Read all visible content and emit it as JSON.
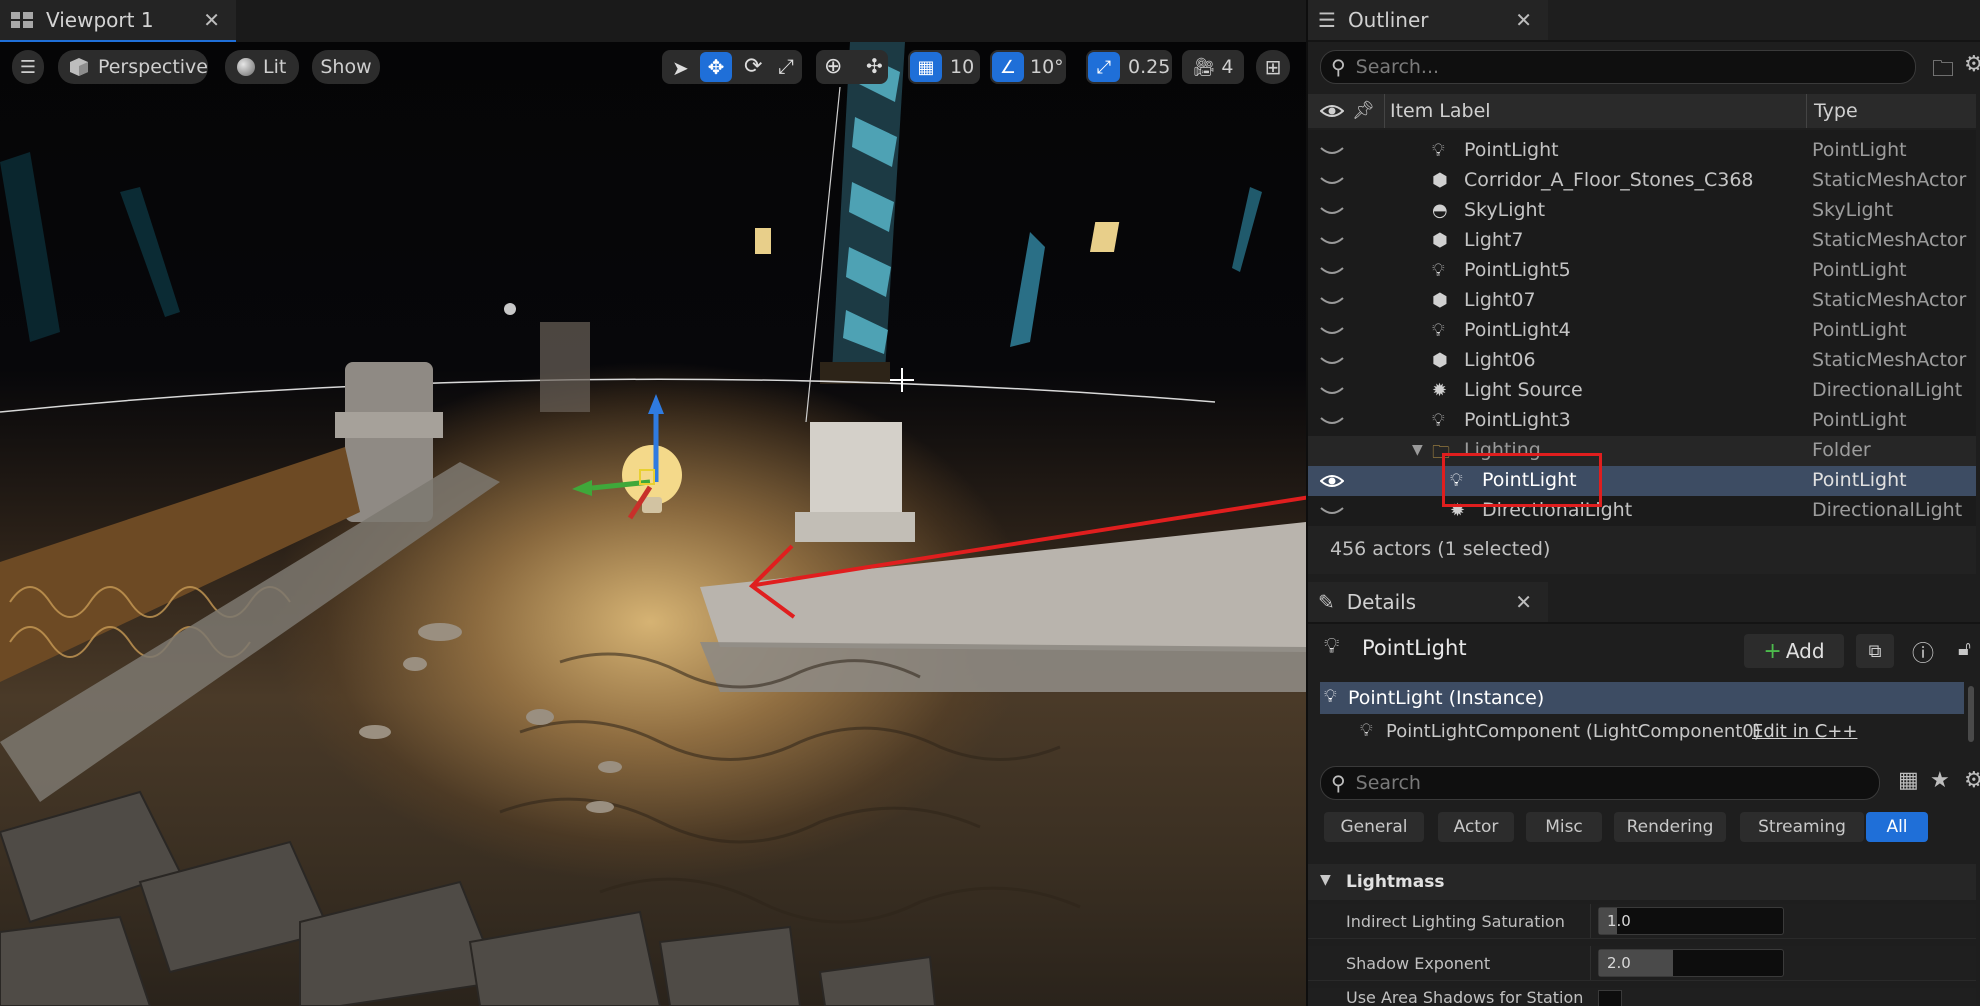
{
  "viewport": {
    "tab_title": "Viewport 1",
    "toolbar": {
      "perspective_label": "Perspective",
      "lit_label": "Lit",
      "show_label": "Show",
      "grid_snap_value": "10",
      "rotation_snap_value": "10°",
      "scale_snap_value": "0.25",
      "camera_speed_value": "4"
    }
  },
  "outliner": {
    "tab_title": "Outliner",
    "search_placeholder": "Search...",
    "col_item_label": "Item Label",
    "col_type": "Type",
    "rows": [
      {
        "label": "PointLight",
        "type": "PointLight",
        "icon": "bulb-icon"
      },
      {
        "label": "Corridor_A_Floor_Stones_C368",
        "type": "StaticMeshActor",
        "icon": "mesh-icon"
      },
      {
        "label": "SkyLight",
        "type": "SkyLight",
        "icon": "skylight-icon"
      },
      {
        "label": "Light7",
        "type": "StaticMeshActor",
        "icon": "mesh-icon"
      },
      {
        "label": "PointLight5",
        "type": "PointLight",
        "icon": "bulb-icon"
      },
      {
        "label": "Light07",
        "type": "StaticMeshActor",
        "icon": "mesh-icon"
      },
      {
        "label": "PointLight4",
        "type": "PointLight",
        "icon": "bulb-icon"
      },
      {
        "label": "Light06",
        "type": "StaticMeshActor",
        "icon": "mesh-icon"
      },
      {
        "label": "Light Source",
        "type": "DirectionalLight",
        "icon": "sun-icon"
      },
      {
        "label": "PointLight3",
        "type": "PointLight",
        "icon": "bulb-icon"
      },
      {
        "label": "Lighting",
        "type": "Folder",
        "icon": "folder-icon"
      },
      {
        "label": "PointLight",
        "type": "PointLight",
        "icon": "bulb-icon"
      },
      {
        "label": "DirectionalLight",
        "type": "DirectionalLight",
        "icon": "sun-icon"
      }
    ],
    "status": "456 actors (1 selected)"
  },
  "details": {
    "tab_title": "Details",
    "actor_name": "PointLight",
    "add_label": "Add",
    "instance_label": "PointLight (Instance)",
    "component_label": "PointLightComponent (LightComponent0)",
    "edit_cpp_label": "Edit in C++",
    "search_placeholder": "Search",
    "filters": [
      "General",
      "Actor",
      "Misc",
      "Rendering",
      "Streaming",
      "All"
    ],
    "section_title": "Lightmass",
    "properties": [
      {
        "label": "Indirect Lighting Saturation",
        "value": "1.0",
        "fill_fraction": 0.1
      },
      {
        "label": "Shadow Exponent",
        "value": "2.0",
        "fill_fraction": 0.4
      },
      {
        "label": "Use Area Shadows for Station"
      }
    ]
  },
  "colors": {
    "accent_blue": "#1f6fd8",
    "selection_row": "#3d4c63",
    "annotation_red": "#e01e1e"
  }
}
